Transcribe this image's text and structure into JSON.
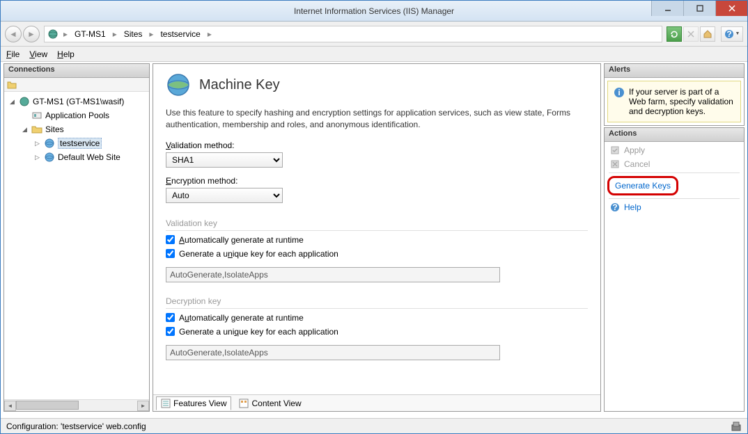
{
  "window": {
    "title": "Internet Information Services (IIS) Manager"
  },
  "breadcrumb": {
    "items": [
      "GT-MS1",
      "Sites",
      "testservice"
    ]
  },
  "menu": {
    "file": "File",
    "view": "View",
    "help": "Help"
  },
  "connections": {
    "title": "Connections",
    "root": "GT-MS1 (GT-MS1\\wasif)",
    "appPools": "Application Pools",
    "sites": "Sites",
    "testservice": "testservice",
    "defaultSite": "Default Web Site"
  },
  "main": {
    "title": "Machine Key",
    "description": "Use this feature to specify hashing and encryption settings for application services, such as view state, Forms authentication, membership and roles, and anonymous identification.",
    "validationMethodLabel": "Validation method:",
    "validationMethod": "SHA1",
    "encryptionMethodLabel": "Encryption method:",
    "encryptionMethod": "Auto",
    "validationKeyLabel": "Validation key",
    "decryptionKeyLabel": "Decryption key",
    "autoGenerate": "Automatically generate at runtime",
    "uniqueKey": "Generate a unique key for each application",
    "keyValue": "AutoGenerate,IsolateApps",
    "featuresView": "Features View",
    "contentView": "Content View"
  },
  "alerts": {
    "title": "Alerts",
    "message": "If your server is part of a Web farm, specify validation and decryption keys."
  },
  "actions": {
    "title": "Actions",
    "apply": "Apply",
    "cancel": "Cancel",
    "generateKeys": "Generate Keys",
    "help": "Help"
  },
  "status": {
    "text": "Configuration: 'testservice' web.config"
  }
}
